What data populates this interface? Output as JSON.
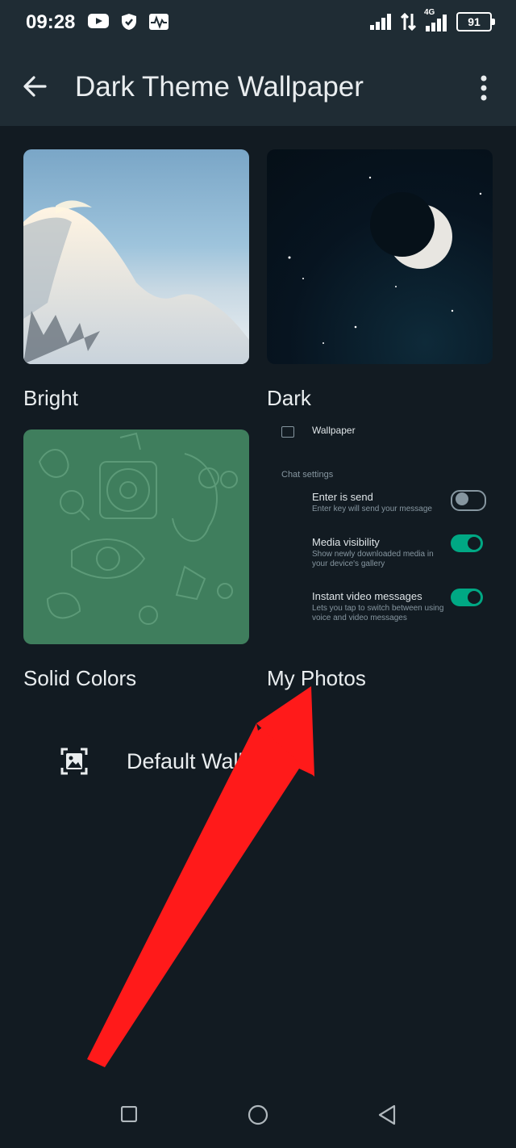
{
  "status_bar": {
    "time": "09:28",
    "battery": "91",
    "network": "4G"
  },
  "app_bar": {
    "title": "Dark Theme Wallpaper",
    "back_icon": "arrow-left-icon",
    "menu_icon": "more-vertical-icon"
  },
  "categories": [
    {
      "label": "Bright"
    },
    {
      "label": "Dark"
    },
    {
      "label": "Solid Colors"
    },
    {
      "label": "My Photos"
    }
  ],
  "my_photos_preview": {
    "header": "Wallpaper",
    "section": "Chat settings",
    "rows": [
      {
        "title": "Enter is send",
        "subtitle": "Enter key will send your message",
        "on": false
      },
      {
        "title": "Media visibility",
        "subtitle": "Show newly downloaded media in your device's gallery",
        "on": true
      },
      {
        "title": "Instant video messages",
        "subtitle": "Lets you tap to switch between using voice and video messages",
        "on": true
      }
    ]
  },
  "default_wallpaper": {
    "label": "Default Wallpaper",
    "icon": "image-icon"
  },
  "colors": {
    "background": "#121b22",
    "appbar": "#1f2c34",
    "solid_tile": "#3f7e5d",
    "toggle_on": "#00a884",
    "annotation_arrow": "#ff1a1a"
  }
}
